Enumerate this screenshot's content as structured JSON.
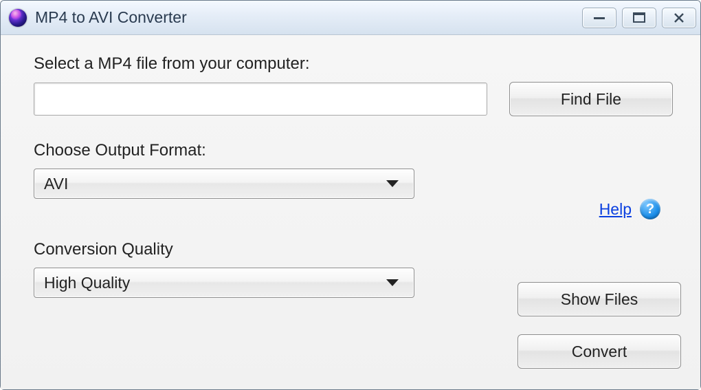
{
  "window": {
    "title": "MP4 to AVI Converter"
  },
  "labels": {
    "select_file": "Select a MP4 file from your computer:",
    "output_format": "Choose Output Format:",
    "conversion_quality": "Conversion Quality"
  },
  "inputs": {
    "file_path_value": "",
    "file_path_placeholder": ""
  },
  "selects": {
    "output_format_value": "AVI",
    "quality_value": "High Quality"
  },
  "buttons": {
    "find_file": "Find File",
    "show_files": "Show Files",
    "convert": "Convert"
  },
  "help": {
    "link_text": "Help",
    "icon_glyph": "?"
  },
  "icons": {
    "app": "sphere-icon",
    "minimize": "minimize-icon",
    "maximize": "maximize-icon",
    "close": "close-icon",
    "caret": "chevron-down-icon",
    "help": "help-icon"
  }
}
